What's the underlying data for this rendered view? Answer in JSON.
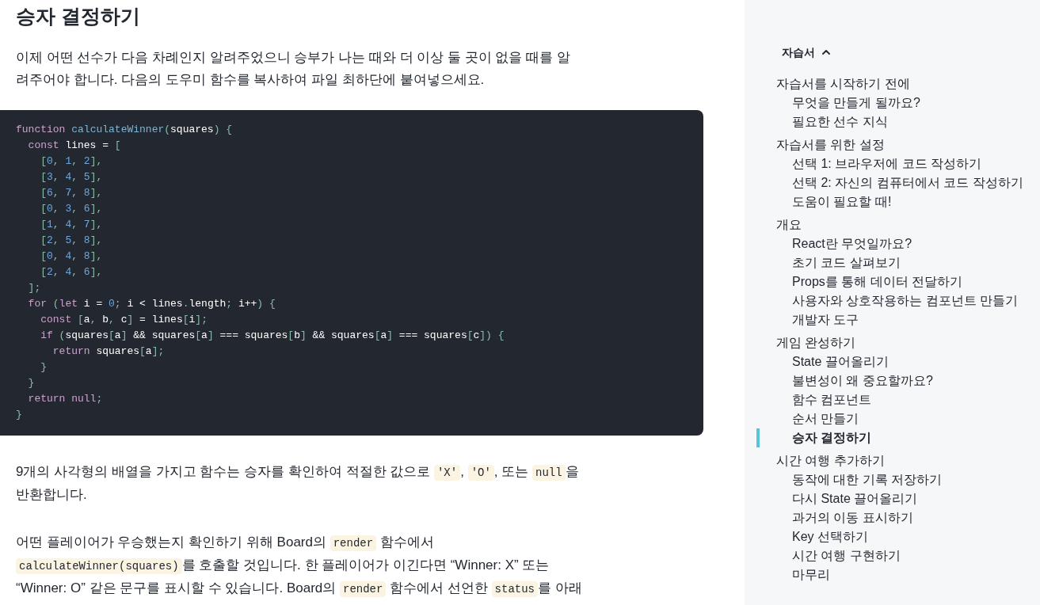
{
  "article": {
    "heading": "승자 결정하기",
    "blocks": [
      {
        "kind": "paragraph",
        "segments": [
          {
            "kind": "text",
            "text": "이제 어떤 선수가 다음 차례인지 알려주었으니 승부가 나는 때와 더 이상 둘 곳이 없을 때를 알려주어야 합니다. 다음의 도우미 함수를 복사하여 파일 최하단에 붙여넣으세요."
          }
        ]
      },
      {
        "kind": "code",
        "lines": [
          [
            {
              "kind": "keyword",
              "text": "function"
            },
            {
              "kind": "definition",
              "text": " calculateWinner"
            },
            {
              "kind": "punctuation",
              "text": "("
            },
            {
              "kind": "plain",
              "text": "squares"
            },
            {
              "kind": "punctuation",
              "text": ")"
            },
            {
              "kind": "punctuation",
              "text": " {"
            }
          ],
          [
            {
              "kind": "keyword",
              "text": "  const"
            },
            {
              "kind": "plain",
              "text": " lines = "
            },
            {
              "kind": "punctuation",
              "text": "["
            }
          ],
          [
            {
              "kind": "punctuation",
              "text": "    ["
            },
            {
              "kind": "number",
              "text": "0"
            },
            {
              "kind": "punctuation",
              "text": ", "
            },
            {
              "kind": "number",
              "text": "1"
            },
            {
              "kind": "punctuation",
              "text": ", "
            },
            {
              "kind": "number",
              "text": "2"
            },
            {
              "kind": "punctuation",
              "text": "],"
            }
          ],
          [
            {
              "kind": "punctuation",
              "text": "    ["
            },
            {
              "kind": "number",
              "text": "3"
            },
            {
              "kind": "punctuation",
              "text": ", "
            },
            {
              "kind": "number",
              "text": "4"
            },
            {
              "kind": "punctuation",
              "text": ", "
            },
            {
              "kind": "number",
              "text": "5"
            },
            {
              "kind": "punctuation",
              "text": "],"
            }
          ],
          [
            {
              "kind": "punctuation",
              "text": "    ["
            },
            {
              "kind": "number",
              "text": "6"
            },
            {
              "kind": "punctuation",
              "text": ", "
            },
            {
              "kind": "number",
              "text": "7"
            },
            {
              "kind": "punctuation",
              "text": ", "
            },
            {
              "kind": "number",
              "text": "8"
            },
            {
              "kind": "punctuation",
              "text": "],"
            }
          ],
          [
            {
              "kind": "punctuation",
              "text": "    ["
            },
            {
              "kind": "number",
              "text": "0"
            },
            {
              "kind": "punctuation",
              "text": ", "
            },
            {
              "kind": "number",
              "text": "3"
            },
            {
              "kind": "punctuation",
              "text": ", "
            },
            {
              "kind": "number",
              "text": "6"
            },
            {
              "kind": "punctuation",
              "text": "],"
            }
          ],
          [
            {
              "kind": "punctuation",
              "text": "    ["
            },
            {
              "kind": "number",
              "text": "1"
            },
            {
              "kind": "punctuation",
              "text": ", "
            },
            {
              "kind": "number",
              "text": "4"
            },
            {
              "kind": "punctuation",
              "text": ", "
            },
            {
              "kind": "number",
              "text": "7"
            },
            {
              "kind": "punctuation",
              "text": "],"
            }
          ],
          [
            {
              "kind": "punctuation",
              "text": "    ["
            },
            {
              "kind": "number",
              "text": "2"
            },
            {
              "kind": "punctuation",
              "text": ", "
            },
            {
              "kind": "number",
              "text": "5"
            },
            {
              "kind": "punctuation",
              "text": ", "
            },
            {
              "kind": "number",
              "text": "8"
            },
            {
              "kind": "punctuation",
              "text": "],"
            }
          ],
          [
            {
              "kind": "punctuation",
              "text": "    ["
            },
            {
              "kind": "number",
              "text": "0"
            },
            {
              "kind": "punctuation",
              "text": ", "
            },
            {
              "kind": "number",
              "text": "4"
            },
            {
              "kind": "punctuation",
              "text": ", "
            },
            {
              "kind": "number",
              "text": "8"
            },
            {
              "kind": "punctuation",
              "text": "],"
            }
          ],
          [
            {
              "kind": "punctuation",
              "text": "    ["
            },
            {
              "kind": "number",
              "text": "2"
            },
            {
              "kind": "punctuation",
              "text": ", "
            },
            {
              "kind": "number",
              "text": "4"
            },
            {
              "kind": "punctuation",
              "text": ", "
            },
            {
              "kind": "number",
              "text": "6"
            },
            {
              "kind": "punctuation",
              "text": "],"
            }
          ],
          [
            {
              "kind": "punctuation",
              "text": "  ];"
            }
          ],
          [
            {
              "kind": "keyword",
              "text": "  for"
            },
            {
              "kind": "punctuation",
              "text": " ("
            },
            {
              "kind": "keyword",
              "text": "let"
            },
            {
              "kind": "plain",
              "text": " i = "
            },
            {
              "kind": "number",
              "text": "0"
            },
            {
              "kind": "punctuation",
              "text": ";"
            },
            {
              "kind": "plain",
              "text": " i < lines"
            },
            {
              "kind": "punctuation",
              "text": "."
            },
            {
              "kind": "plain",
              "text": "length"
            },
            {
              "kind": "punctuation",
              "text": ";"
            },
            {
              "kind": "plain",
              "text": " i++"
            },
            {
              "kind": "punctuation",
              "text": ")"
            },
            {
              "kind": "punctuation",
              "text": " {"
            }
          ],
          [
            {
              "kind": "keyword",
              "text": "    const"
            },
            {
              "kind": "punctuation",
              "text": " ["
            },
            {
              "kind": "plain",
              "text": "a"
            },
            {
              "kind": "punctuation",
              "text": ", "
            },
            {
              "kind": "plain",
              "text": "b"
            },
            {
              "kind": "punctuation",
              "text": ", "
            },
            {
              "kind": "plain",
              "text": "c"
            },
            {
              "kind": "punctuation",
              "text": "]"
            },
            {
              "kind": "plain",
              "text": " = lines"
            },
            {
              "kind": "punctuation",
              "text": "["
            },
            {
              "kind": "plain",
              "text": "i"
            },
            {
              "kind": "punctuation",
              "text": "];"
            }
          ],
          [
            {
              "kind": "keyword",
              "text": "    if"
            },
            {
              "kind": "punctuation",
              "text": " ("
            },
            {
              "kind": "plain",
              "text": "squares"
            },
            {
              "kind": "punctuation",
              "text": "["
            },
            {
              "kind": "plain",
              "text": "a"
            },
            {
              "kind": "punctuation",
              "text": "]"
            },
            {
              "kind": "plain",
              "text": " && squares"
            },
            {
              "kind": "punctuation",
              "text": "["
            },
            {
              "kind": "plain",
              "text": "a"
            },
            {
              "kind": "punctuation",
              "text": "]"
            },
            {
              "kind": "plain",
              "text": " === squares"
            },
            {
              "kind": "punctuation",
              "text": "["
            },
            {
              "kind": "plain",
              "text": "b"
            },
            {
              "kind": "punctuation",
              "text": "]"
            },
            {
              "kind": "plain",
              "text": " && squares"
            },
            {
              "kind": "punctuation",
              "text": "["
            },
            {
              "kind": "plain",
              "text": "a"
            },
            {
              "kind": "punctuation",
              "text": "]"
            },
            {
              "kind": "plain",
              "text": " === squares"
            },
            {
              "kind": "punctuation",
              "text": "["
            },
            {
              "kind": "plain",
              "text": "c"
            },
            {
              "kind": "punctuation",
              "text": "])"
            },
            {
              "kind": "punctuation",
              "text": " {"
            }
          ],
          [
            {
              "kind": "keyword",
              "text": "      return"
            },
            {
              "kind": "plain",
              "text": " squares"
            },
            {
              "kind": "punctuation",
              "text": "["
            },
            {
              "kind": "plain",
              "text": "a"
            },
            {
              "kind": "punctuation",
              "text": "];"
            }
          ],
          [
            {
              "kind": "punctuation",
              "text": "    }"
            }
          ],
          [
            {
              "kind": "punctuation",
              "text": "  }"
            }
          ],
          [
            {
              "kind": "keyword",
              "text": "  return"
            },
            {
              "kind": "keyword",
              "text": " null"
            },
            {
              "kind": "punctuation",
              "text": ";"
            }
          ],
          [
            {
              "kind": "punctuation",
              "text": "}"
            }
          ]
        ]
      },
      {
        "kind": "paragraph",
        "segments": [
          {
            "kind": "text",
            "text": "9개의 사각형의 배열을 가지고 함수는 승자를 확인하여 적절한 값으로 "
          },
          {
            "kind": "code",
            "text": "'X'"
          },
          {
            "kind": "text",
            "text": ", "
          },
          {
            "kind": "code",
            "text": "'O'"
          },
          {
            "kind": "text",
            "text": ", 또는 "
          },
          {
            "kind": "code",
            "text": "null"
          },
          {
            "kind": "text",
            "text": "을 반환합니다."
          }
        ]
      },
      {
        "kind": "paragraph",
        "segments": [
          {
            "kind": "text",
            "text": "어떤 플레이어가 우승했는지 확인하기 위해 Board의 "
          },
          {
            "kind": "code",
            "text": "render"
          },
          {
            "kind": "text",
            "text": " 함수에서 "
          },
          {
            "kind": "code",
            "text": "calculateWinner(squares)"
          },
          {
            "kind": "text",
            "text": "를 호출할 것입니다. 한 플레이어가 이긴다면 “Winner: X” 또는 “Winner: O” 같은 문구를 표시할 수 있습니다. Board의 "
          },
          {
            "kind": "code",
            "text": "render"
          },
          {
            "kind": "text",
            "text": " 함수에서 선언한 "
          },
          {
            "kind": "code",
            "text": "status"
          },
          {
            "kind": "text",
            "text": "를 아래"
          }
        ]
      }
    ]
  },
  "sidebar": {
    "title": "자습서",
    "expanded": true,
    "items": [
      {
        "label": "자습서를 시작하기 전에",
        "selected": false,
        "children": [
          {
            "label": "무엇을 만들게 될까요?",
            "selected": false
          },
          {
            "label": "필요한 선수 지식",
            "selected": false
          }
        ]
      },
      {
        "label": "자습서를 위한 설정",
        "selected": false,
        "children": [
          {
            "label": "선택 1: 브라우저에 코드 작성하기",
            "selected": false
          },
          {
            "label": "선택 2: 자신의 컴퓨터에서 코드 작성하기",
            "selected": false
          },
          {
            "label": "도움이 필요할 때!",
            "selected": false
          }
        ]
      },
      {
        "label": "개요",
        "selected": false,
        "children": [
          {
            "label": "React란 무엇일까요?",
            "selected": false
          },
          {
            "label": "초기 코드 살펴보기",
            "selected": false
          },
          {
            "label": "Props를 통해 데이터 전달하기",
            "selected": false
          },
          {
            "label": "사용자와 상호작용하는 컴포넌트 만들기",
            "selected": false
          },
          {
            "label": "개발자 도구",
            "selected": false
          }
        ]
      },
      {
        "label": "게임 완성하기",
        "selected": false,
        "children": [
          {
            "label": "State 끌어올리기",
            "selected": false
          },
          {
            "label": "불변성이 왜 중요할까요?",
            "selected": false
          },
          {
            "label": "함수 컴포넌트",
            "selected": false
          },
          {
            "label": "순서 만들기",
            "selected": false
          },
          {
            "label": "승자 결정하기",
            "selected": true
          }
        ]
      },
      {
        "label": "시간 여행 추가하기",
        "selected": false,
        "children": [
          {
            "label": "동작에 대한 기록 저장하기",
            "selected": false
          },
          {
            "label": "다시 State 끌어올리기",
            "selected": false
          },
          {
            "label": "과거의 이동 표시하기",
            "selected": false
          },
          {
            "label": "Key 선택하기",
            "selected": false
          },
          {
            "label": "시간 여행 구현하기",
            "selected": false
          },
          {
            "label": "마무리",
            "selected": false
          }
        ]
      }
    ]
  }
}
